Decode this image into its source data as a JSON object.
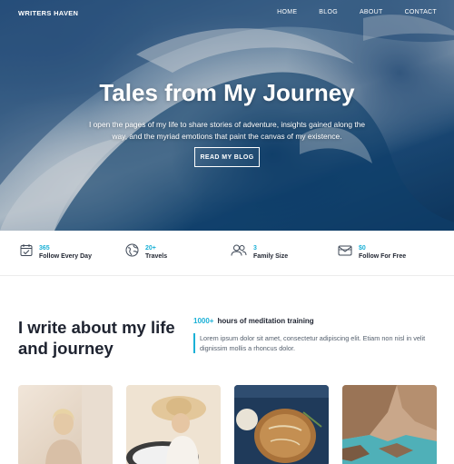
{
  "brand": "WRITERS HAVEN",
  "nav": {
    "home": "HOME",
    "blog": "BLOG",
    "about": "ABOUT",
    "contact": "CONTACT"
  },
  "hero": {
    "title": "Tales from My Journey",
    "subtitle": "I open the pages of my life to share stories of adventure, insights gained along the way, and the myriad emotions that paint the canvas of my existence.",
    "button": "READ MY BLOG"
  },
  "stats": [
    {
      "icon": "calendar-icon",
      "value": "365",
      "label": "Follow Every Day"
    },
    {
      "icon": "globe-icon",
      "value": "20+",
      "label": "Travels"
    },
    {
      "icon": "users-icon",
      "value": "3",
      "label": "Family Size"
    },
    {
      "icon": "envelope-icon",
      "value": "$0",
      "label": "Follow For Free"
    }
  ],
  "about": {
    "heading": "I write about my life and journey",
    "metric_number": "1000+",
    "metric_text": "hours of meditation training",
    "quote": "Lorem ipsum dolor sit amet, consectetur adipiscing elit. Etiam non nisl in velit dignissim mollis a rhoncus dolor."
  },
  "cards": [
    {
      "image": "woman-meditating-photo"
    },
    {
      "image": "woman-in-sun-hat-photo"
    },
    {
      "image": "bread-loaf-photo"
    },
    {
      "image": "rocky-coast-photo"
    }
  ],
  "colors": {
    "accent": "#1ab0d6",
    "text_dark": "#1e2330",
    "text_muted": "#55606e"
  }
}
